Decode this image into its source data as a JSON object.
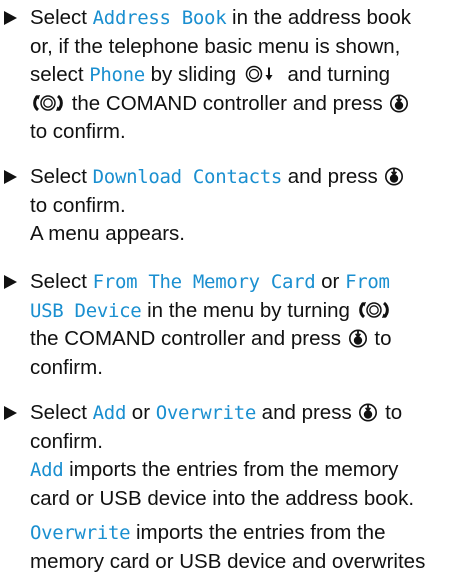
{
  "steps": [
    {
      "lines": [
        {
          "parts": [
            {
              "t": "Select "
            },
            {
              "ui": "Address Book"
            },
            {
              "t": " in the address book"
            }
          ]
        },
        {
          "parts": [
            {
              "t": "or, if the telephone basic menu is shown,"
            }
          ]
        },
        {
          "parts": [
            {
              "t": "select "
            },
            {
              "ui": "Phone"
            },
            {
              "t": " by sliding "
            },
            {
              "icon": "slide-down-controller-icon"
            },
            {
              "t": " and turning"
            }
          ]
        },
        {
          "parts": [
            {
              "icon": "turn-controller-icon"
            },
            {
              "t": " the COMAND controller and press "
            },
            {
              "icon": "press-controller-icon"
            }
          ]
        },
        {
          "parts": [
            {
              "t": "to confirm."
            }
          ]
        }
      ]
    },
    {
      "lines": [
        {
          "parts": [
            {
              "t": "Select "
            },
            {
              "ui": "Download Contacts"
            },
            {
              "t": " and press "
            },
            {
              "icon": "press-controller-icon"
            }
          ]
        },
        {
          "parts": [
            {
              "t": "to confirm."
            }
          ]
        },
        {
          "parts": [
            {
              "t": "A menu appears."
            }
          ]
        }
      ]
    },
    {
      "lines": [
        {
          "parts": [
            {
              "t": "Select "
            },
            {
              "ui": "From The Memory Card"
            },
            {
              "t": " or "
            },
            {
              "ui": "From"
            }
          ]
        },
        {
          "parts": [
            {
              "ui": "USB Device"
            },
            {
              "t": " in the menu by turning "
            },
            {
              "icon": "turn-controller-icon"
            }
          ]
        },
        {
          "parts": [
            {
              "t": "the COMAND controller and press "
            },
            {
              "icon": "press-controller-icon"
            },
            {
              "t": " to"
            }
          ]
        },
        {
          "parts": [
            {
              "t": "confirm."
            }
          ]
        }
      ]
    },
    {
      "lines": [
        {
          "parts": [
            {
              "t": "Select "
            },
            {
              "ui": "Add"
            },
            {
              "t": " or "
            },
            {
              "ui": "Overwrite"
            },
            {
              "t": " and press "
            },
            {
              "icon": "press-controller-icon"
            },
            {
              "t": " to"
            }
          ]
        },
        {
          "parts": [
            {
              "t": "confirm."
            }
          ]
        },
        {
          "parts": [
            {
              "ui": "Add"
            },
            {
              "t": " imports the entries from the memory"
            }
          ]
        },
        {
          "parts": [
            {
              "t": "card or USB device into the address book."
            }
          ]
        },
        {
          "gap": true
        },
        {
          "parts": [
            {
              "ui": "Overwrite"
            },
            {
              "t": " imports the entries from the"
            }
          ]
        },
        {
          "parts": [
            {
              "t": "memory card or USB device and overwrites"
            }
          ]
        }
      ]
    }
  ],
  "colors": {
    "text": "#111111",
    "ui_term": "#1a8fd0",
    "background": "#ffffff"
  }
}
